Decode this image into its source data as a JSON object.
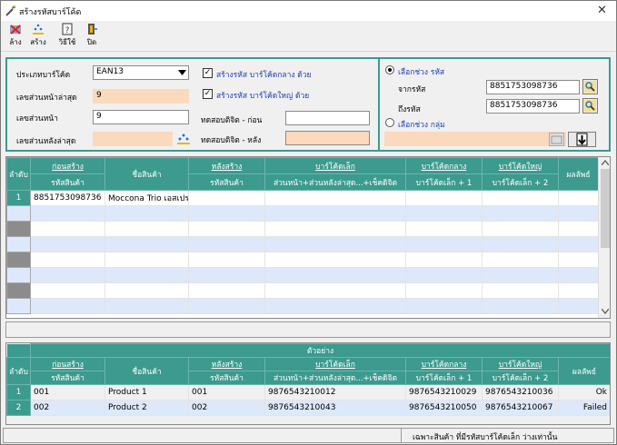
{
  "window": {
    "title": "สร้างรหัสบาร์โค้ด",
    "close_glyph": "✕"
  },
  "toolbar": [
    {
      "name": "clear-button",
      "label": "ล้าง",
      "icon": "clear-icon"
    },
    {
      "name": "generate-button",
      "label": "สร้าง",
      "icon": "generate-icon"
    },
    {
      "name": "help-button",
      "label": "วิธีใช้",
      "icon": "help-icon"
    },
    {
      "name": "close-button",
      "label": "ปิด",
      "icon": "exit-icon"
    }
  ],
  "form": {
    "barcode_type_label": "ประเภทบาร์โค้ด",
    "barcode_type_value": "EAN13",
    "last_prefix_label": "เลขส่วนหน้าล่าสุด",
    "last_prefix_value": "9",
    "prefix_label": "เลขส่วนหน้า",
    "prefix_value": "9",
    "last_suffix_label": "เลขส่วนหลังล่าสุด",
    "last_suffix_value": "",
    "chk_mid_label": "สร้างรหัส บาร์โค้ดกลาง ด้วย",
    "chk_big_label": "สร้างรหัส บาร์โค้ดใหญ่ ด้วย",
    "test_before_label": "ทดสอบติจิต - ก่อน",
    "test_before_value": "",
    "test_after_label": "ทดสอบติจิต - หลัง",
    "test_after_value": ""
  },
  "range": {
    "by_code_label": "เลือกช่วง รหัส",
    "from_label": "จากรหัส",
    "from_value": "8851753098736",
    "to_label": "ถึงรหัส",
    "to_value": "8851753098736",
    "by_group_label": "เลือกช่วง กลุ่ม",
    "group_value": ""
  },
  "main_table": {
    "headers": {
      "seq": "ลำดับ",
      "before": "ก่อนสร้าง",
      "before_sub": "รหัสสินค้า",
      "name": "ชื่อสินค้า",
      "after": "หลังสร้าง",
      "after_sub": "รหัสสินค้า",
      "small": "บาร์โค้ดเล็ก",
      "small_sub": "ส่วนหน้า+ส่วนหลังล่าสุด...+เช็คดิจิต",
      "mid": "บาร์โค้ดกลาง",
      "mid_sub": "บาร์โค้ดเล็ก + 1",
      "big": "บาร์โค้ดใหญ่",
      "big_sub": "บาร์โค้ดเล็ก + 2",
      "result": "ผลลัพธ์"
    },
    "rows": [
      {
        "seq": "1",
        "code": "8851753098736",
        "name": "Moccona Trio เอสเปร",
        "after": "",
        "small": "",
        "mid": "",
        "big": "",
        "result": ""
      }
    ]
  },
  "sample_table": {
    "caption": "ตัวอย่าง",
    "headers": {
      "seq": "ลำดับ",
      "before": "ก่อนสร้าง",
      "before_sub": "รหัสสินค้า",
      "name": "ชื่อสินค้า",
      "after": "หลังสร้าง",
      "after_sub": "รหัสสินค้า",
      "small": "บาร์โค้ดเล็ก",
      "small_sub": "ส่วนหน้า+ส่วนหลังล่าสุด...+เช็คดิจิต",
      "mid": "บาร์โค้ดกลาง",
      "mid_sub": "บาร์โค้ดเล็ก + 1",
      "big": "บาร์โค้ดใหญ่",
      "big_sub": "บาร์โค้ดเล็ก + 2",
      "result": "ผลลัพธ์"
    },
    "rows": [
      {
        "seq": "1",
        "code": "001",
        "name": "Product 1",
        "after": "001",
        "small": "9876543210012",
        "mid": "9876543210029",
        "big": "9876543210036",
        "result": "Ok"
      },
      {
        "seq": "2",
        "code": "002",
        "name": "Product 2",
        "after": "002",
        "small": "9876543210043",
        "mid": "9876543210050",
        "big": "9876543210067",
        "result": "Failed"
      }
    ]
  },
  "status_note": "เฉพาะสินค้า ที่มีรหัสบาร์โค้ดเล็ก ว่างเท่านั้น",
  "colors": {
    "header_teal": "#3c9a8f",
    "peach": "#fbd9bd",
    "row_alt": "#dde8fb",
    "label_blue": "#1a3fb0"
  }
}
